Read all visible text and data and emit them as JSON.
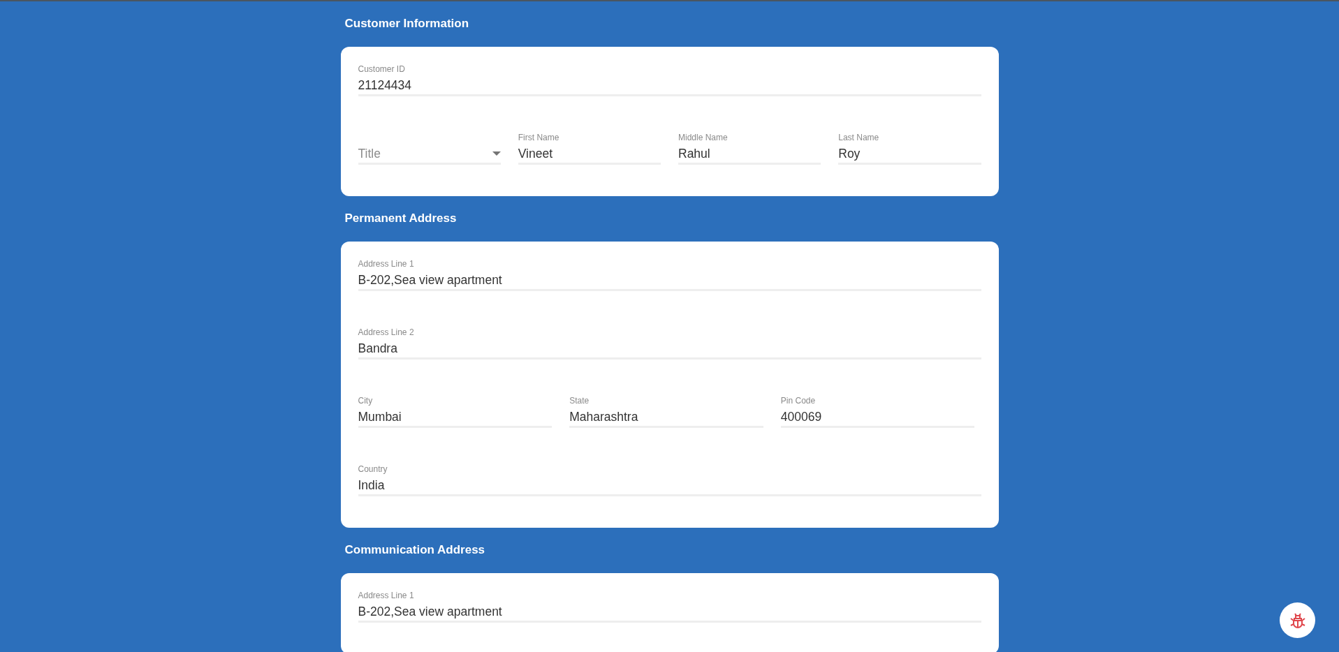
{
  "sections": [
    {
      "title": "Customer Information",
      "rows": [
        [
          {
            "kind": "text",
            "label": "Customer ID",
            "value": "21124434"
          }
        ],
        [
          {
            "kind": "select",
            "placeholder": "Title"
          },
          {
            "kind": "text",
            "label": "First Name",
            "value": "Vineet"
          },
          {
            "kind": "text",
            "label": "Middle Name",
            "value": "Rahul"
          },
          {
            "kind": "text",
            "label": "Last Name",
            "value": "Roy"
          }
        ]
      ]
    },
    {
      "title": "Permanent Address",
      "rows": [
        [
          {
            "kind": "text",
            "label": "Address Line 1",
            "value": "B-202,Sea view apartment"
          }
        ],
        [
          {
            "kind": "text",
            "label": "Address Line 2",
            "value": "Bandra"
          }
        ],
        [
          {
            "kind": "text",
            "label": "City",
            "value": "Mumbai"
          },
          {
            "kind": "text",
            "label": "State",
            "value": "Maharashtra"
          },
          {
            "kind": "text",
            "label": "Pin Code",
            "value": "400069"
          }
        ],
        [
          {
            "kind": "text",
            "label": "Country",
            "value": "India"
          }
        ]
      ]
    },
    {
      "title": "Communication Address",
      "rows": [
        [
          {
            "kind": "text",
            "label": "Address Line 1",
            "value": "B-202,Sea view apartment"
          }
        ]
      ]
    }
  ]
}
